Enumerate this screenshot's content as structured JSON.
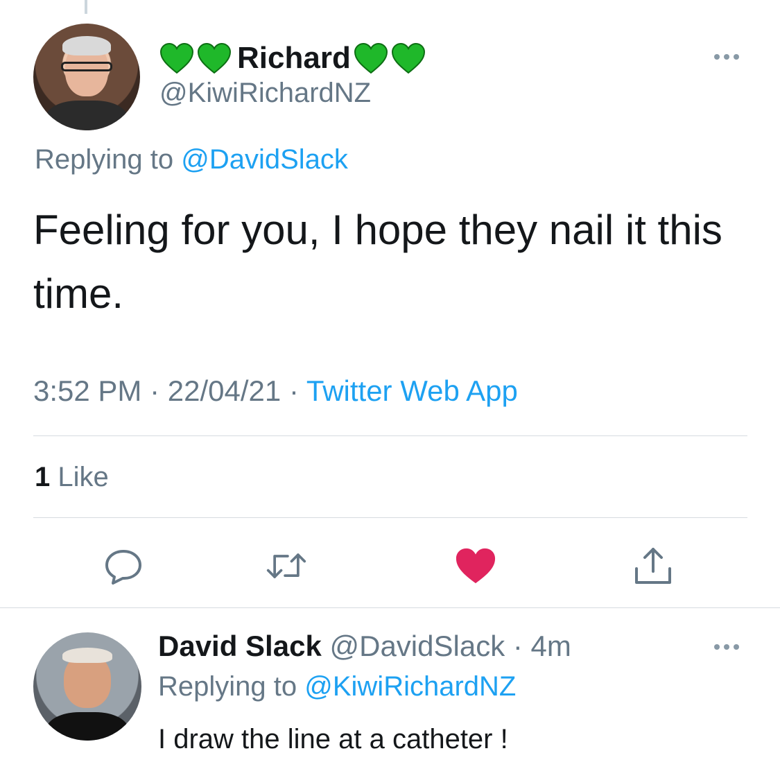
{
  "tweet": {
    "display_name": "Richard",
    "handle": "@KiwiRichardNZ",
    "replying_prefix": "Replying to",
    "replying_to": "@DavidSlack",
    "text": "Feeling for you, I hope they nail it this time.",
    "time": "3:52 PM",
    "date": "22/04/21",
    "source": "Twitter Web App",
    "like_count": "1",
    "like_label": "Like",
    "separator": "·"
  },
  "reply": {
    "display_name": "David Slack",
    "handle": "@DavidSlack",
    "age": "4m",
    "replying_prefix": "Replying to",
    "replying_to": "@KiwiRichardNZ",
    "text": "I draw the line at a catheter !",
    "separator": "·"
  },
  "colors": {
    "link": "#1da1f2",
    "secondary_text": "#657786",
    "heart_emoji": "#1fb82a",
    "like_active": "#e0245e"
  },
  "icons": [
    "green-heart-icon",
    "more-icon",
    "reply-icon",
    "retweet-icon",
    "like-icon",
    "share-icon"
  ]
}
